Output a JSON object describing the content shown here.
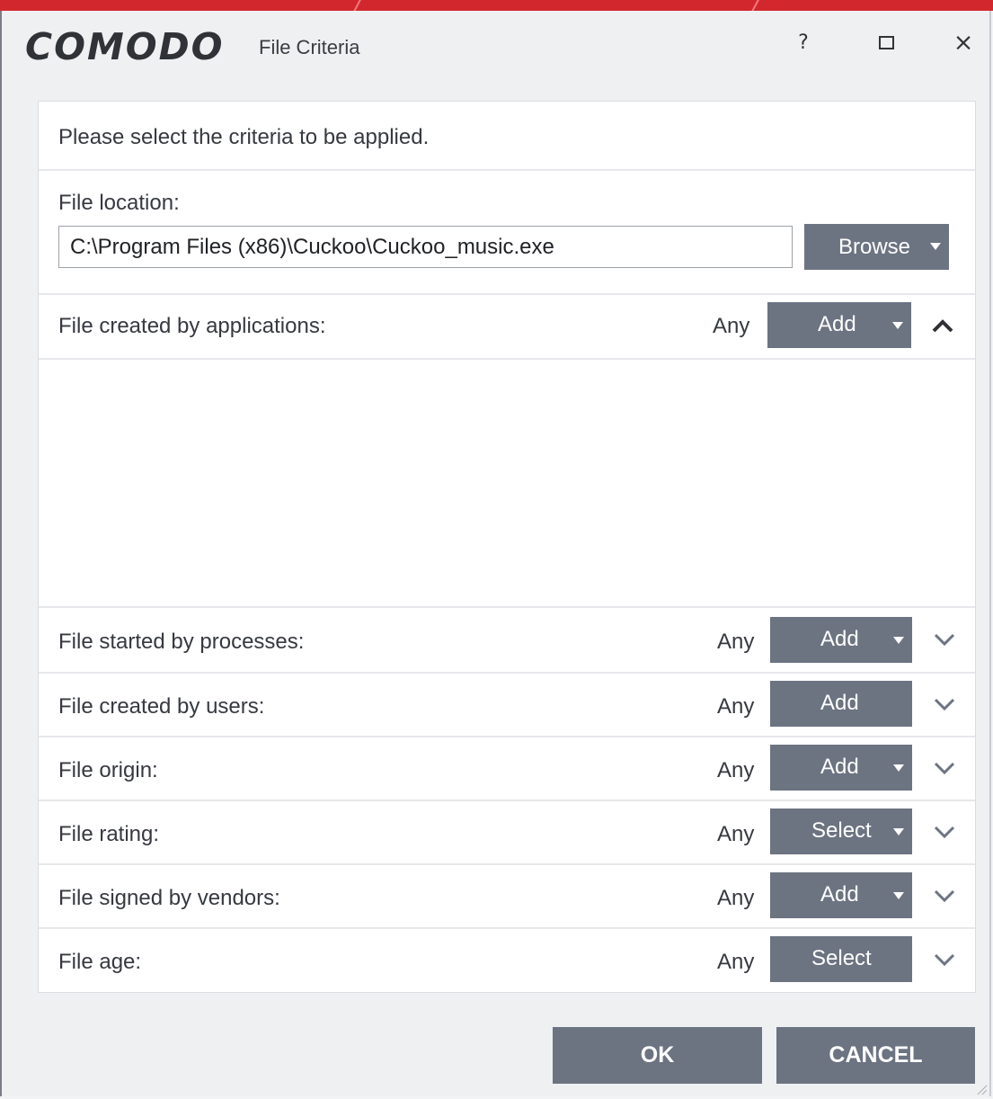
{
  "window": {
    "brand": "COMODO",
    "title": "File Criteria",
    "help_glyph": "?",
    "close_glyph": "×"
  },
  "intro": "Please select the criteria to be applied.",
  "file_location": {
    "label": "File location:",
    "value": "C:\\Program Files (x86)\\Cuckoo\\Cuckoo_music.exe",
    "browse_label": "Browse"
  },
  "criteria": [
    {
      "label": "File created by applications:",
      "value": "Any",
      "button": "Add",
      "has_dropdown": true,
      "expanded": true
    },
    {
      "label": "File started by processes:",
      "value": "Any",
      "button": "Add",
      "has_dropdown": true,
      "expanded": false
    },
    {
      "label": "File created by users:",
      "value": "Any",
      "button": "Add",
      "has_dropdown": false,
      "expanded": false
    },
    {
      "label": "File origin:",
      "value": "Any",
      "button": "Add",
      "has_dropdown": true,
      "expanded": false
    },
    {
      "label": "File rating:",
      "value": "Any",
      "button": "Select",
      "has_dropdown": true,
      "expanded": false
    },
    {
      "label": "File signed by vendors:",
      "value": "Any",
      "button": "Add",
      "has_dropdown": true,
      "expanded": false
    },
    {
      "label": "File age:",
      "value": "Any",
      "button": "Select",
      "has_dropdown": false,
      "expanded": false
    }
  ],
  "footer": {
    "ok": "OK",
    "cancel": "CANCEL"
  },
  "colors": {
    "accent_red": "#d2272d",
    "button_gray": "#6c7381",
    "panel_bg": "#ffffff",
    "window_bg": "#eef0f2"
  },
  "icons": [
    "help-icon",
    "maximize-icon",
    "close-icon",
    "chevron-up-icon",
    "chevron-down-icon",
    "dropdown-caret-icon"
  ]
}
